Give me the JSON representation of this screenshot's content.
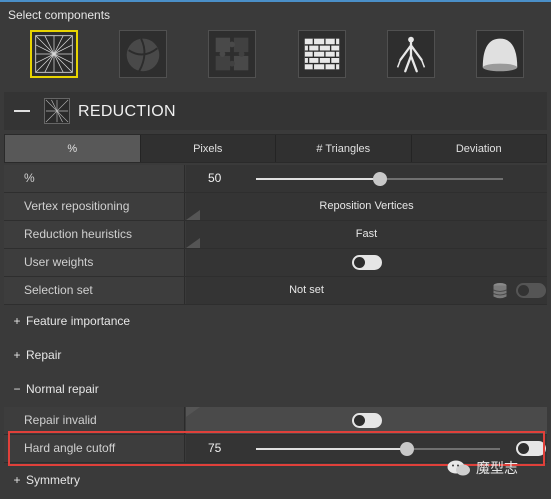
{
  "header": {
    "title": "Select components"
  },
  "components": [
    {
      "name": "reduction-component-icon",
      "selected": true
    },
    {
      "name": "sphere-component-icon",
      "selected": false
    },
    {
      "name": "puzzle-component-icon",
      "selected": false
    },
    {
      "name": "brick-wall-component-icon",
      "selected": false
    },
    {
      "name": "skeleton-component-icon",
      "selected": false
    },
    {
      "name": "dome-component-icon",
      "selected": false
    }
  ],
  "reduction": {
    "title": "REDUCTION",
    "tabs": [
      "%",
      "Pixels",
      "# Triangles",
      "Deviation"
    ],
    "active_tab": "%",
    "rows": {
      "percent": {
        "label": "%",
        "value": "50",
        "slider_fraction": 0.5
      },
      "vertex_repositioning": {
        "label": "Vertex repositioning",
        "value": "Reposition Vertices"
      },
      "reduction_heuristics": {
        "label": "Reduction heuristics",
        "value": "Fast"
      },
      "user_weights": {
        "label": "User weights",
        "toggle": "off"
      },
      "selection_set": {
        "label": "Selection set",
        "value": "Not set",
        "toggle": "off"
      }
    }
  },
  "sections": {
    "feature_importance": {
      "symbol": "+",
      "label": "Feature importance"
    },
    "repair": {
      "symbol": "+",
      "label": "Repair"
    },
    "normal_repair": {
      "symbol": "−",
      "label": "Normal repair"
    },
    "symmetry": {
      "symbol": "+",
      "label": "Symmetry"
    }
  },
  "normal_repair_rows": {
    "repair_invalid": {
      "label": "Repair invalid",
      "toggle": "off"
    },
    "hard_angle_cutoff": {
      "label": "Hard angle cutoff",
      "value": "75",
      "slider_fraction": 0.62,
      "toggle": "off"
    }
  },
  "watermark": {
    "text": "魔型志"
  },
  "colors": {
    "accent_selected": "#e8d400",
    "highlight_box": "#e0403a",
    "top_line": "#4a8fc8"
  }
}
